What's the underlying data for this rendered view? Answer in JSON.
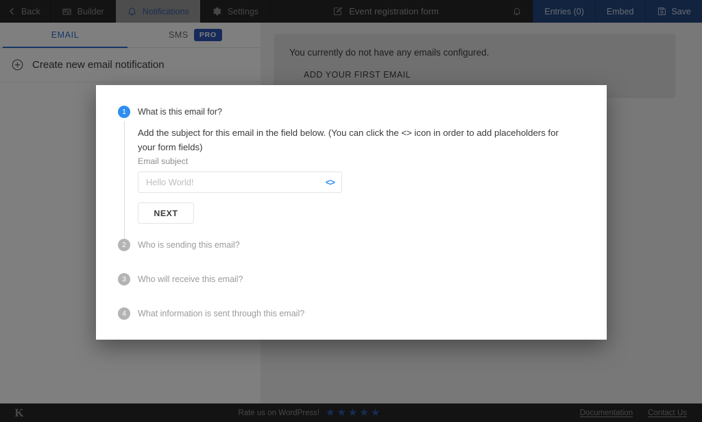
{
  "topbar": {
    "back": "Back",
    "tabs": [
      {
        "label": "Builder",
        "icon": "blocks-icon"
      },
      {
        "label": "Notifications",
        "icon": "bell-icon"
      },
      {
        "label": "Settings",
        "icon": "gear-icon"
      }
    ],
    "form_title": "Event registration form",
    "form_title_icon": "pencil-edit-icon",
    "bell_icon": "bell-icon",
    "entries": "Entries (0)",
    "embed": "Embed",
    "save": "Save",
    "save_icon": "floppy-save-icon",
    "accent_blue": "#23477d",
    "active_tab_text": "#3d5c9e"
  },
  "sidebar": {
    "tabs": [
      {
        "label": "EMAIL",
        "badge": null
      },
      {
        "label": "SMS",
        "badge": "PRO"
      }
    ],
    "create_label": "Create new email notification",
    "create_icon": "plus-circle-icon"
  },
  "content": {
    "empty_message": "You currently do not have any emails configured.",
    "add_first_email": "ADD YOUR FIRST EMAIL"
  },
  "modal": {
    "steps": [
      {
        "number": "1",
        "title": "What is this email for?",
        "active": true,
        "description": "Add the subject for this email in the field below. (You can click the <> icon in order to add placeholders for your form fields)",
        "field_label": "Email subject",
        "subject_value": "",
        "subject_placeholder": "Hello World!",
        "code_icon": "<>",
        "next_label": "NEXT"
      },
      {
        "number": "2",
        "title": "Who is sending this email?",
        "active": false
      },
      {
        "number": "3",
        "title": "Who will receive this email?",
        "active": false
      },
      {
        "number": "4",
        "title": "What information is sent through this email?",
        "active": false
      }
    ],
    "active_dot_color": "#2f8ef0",
    "inactive_dot_color": "#b4b4b4"
  },
  "footer": {
    "logo": "K",
    "rate_text": "Rate us on WordPress!",
    "stars": [
      "★",
      "★",
      "★",
      "★",
      "★"
    ],
    "star_color": "#2f5aa8",
    "links": [
      "Documentation",
      "Contact Us"
    ]
  }
}
